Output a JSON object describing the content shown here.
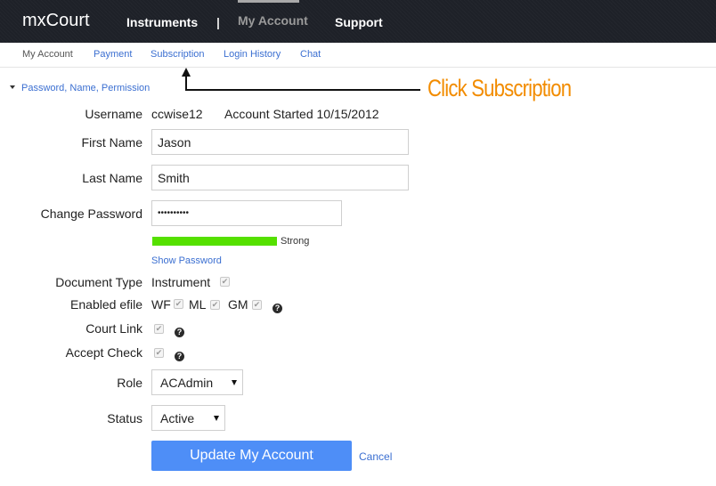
{
  "header": {
    "brand": "mxCourt",
    "nav": [
      "Instruments",
      "My Account",
      "Support"
    ],
    "separator": "|",
    "active_nav": "My Account"
  },
  "subnav": {
    "items": [
      "My Account",
      "Payment",
      "Subscription",
      "Login History",
      "Chat"
    ],
    "current": "My Account"
  },
  "section": {
    "title": "Password, Name, Permission",
    "expanded": true
  },
  "annotation": {
    "text": "Click Subscription",
    "color": "#f28c00",
    "target": "Subscription"
  },
  "form": {
    "username_label": "Username",
    "username": "ccwise12",
    "account_started": "Account Started 10/15/2012",
    "first_name_label": "First Name",
    "first_name": "Jason",
    "last_name_label": "Last Name",
    "last_name": "Smith",
    "password_label": "Change Password",
    "password_masked": "••••••••••",
    "password_strength": {
      "label": "Strong",
      "percent": 100,
      "color": "#55e000"
    },
    "show_password": "Show Password",
    "document_type_label": "Document Type",
    "document_type": "Instrument",
    "document_type_checked": true,
    "efile_label": "Enabled efile",
    "efile_options": [
      {
        "label": "WF",
        "checked": true
      },
      {
        "label": "ML",
        "checked": true
      },
      {
        "label": "GM",
        "checked": true
      }
    ],
    "court_link_label": "Court Link",
    "court_link_checked": true,
    "accept_check_label": "Accept Check",
    "accept_check_checked": true,
    "role_label": "Role",
    "role": "ACAdmin",
    "status_label": "Status",
    "status": "Active",
    "help_glyph": "?",
    "check_glyph": "✔"
  },
  "actions": {
    "update": "Update My Account",
    "cancel": "Cancel",
    "update_color": "#4e8ef7"
  }
}
